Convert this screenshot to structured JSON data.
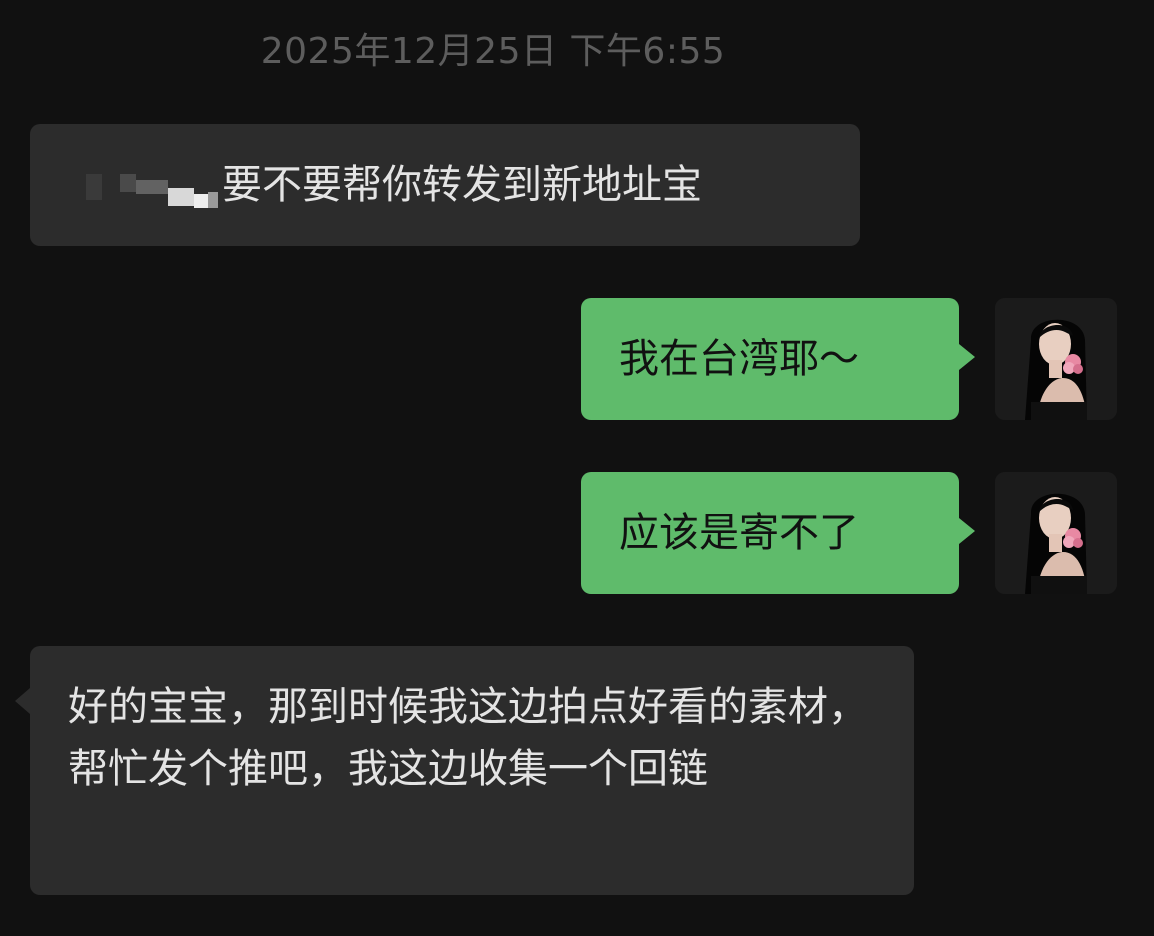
{
  "timestamp": "2025年12月25日 下午6:55",
  "messages": [
    {
      "direction": "incoming",
      "text": "要不要帮你转发到新地址宝"
    },
    {
      "direction": "outgoing",
      "text": "我在台湾耶～"
    },
    {
      "direction": "outgoing",
      "text": "应该是寄不了"
    },
    {
      "direction": "incoming",
      "text": "好的宝宝，那到时候我这边拍点好看的素材，帮忙发个推吧，我这边收集一个回链"
    }
  ],
  "colors": {
    "background": "#111111",
    "incoming_bubble": "#2c2c2c",
    "outgoing_bubble": "#5fbb6b",
    "timestamp_text": "#5d5d5d",
    "incoming_text": "#e4e4e4",
    "outgoing_text": "#111111"
  },
  "icons": {
    "avatar": "user-avatar-photo",
    "redaction": "mosaic-redacted-name"
  }
}
